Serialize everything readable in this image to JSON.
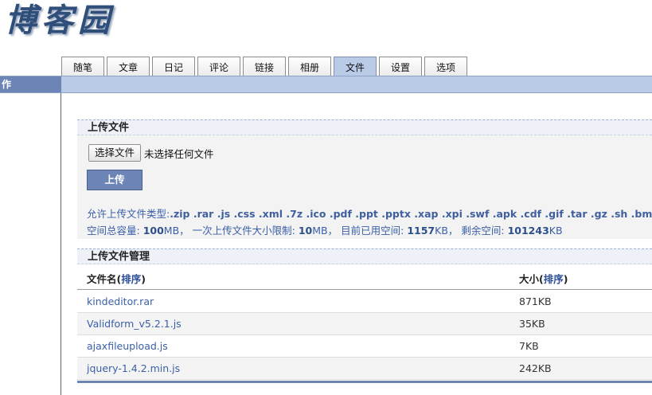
{
  "logo": {
    "text": "博客园"
  },
  "tabs": [
    {
      "label": "随笔"
    },
    {
      "label": "文章"
    },
    {
      "label": "日记"
    },
    {
      "label": "评论"
    },
    {
      "label": "链接"
    },
    {
      "label": "相册"
    },
    {
      "label": "文件",
      "active": true
    },
    {
      "label": "设置"
    },
    {
      "label": "选项"
    }
  ],
  "topbar": {
    "label": "作"
  },
  "upload": {
    "header": "上传文件",
    "choose_button": "选择文件",
    "no_file_text": "未选择任何文件",
    "upload_button": "上传",
    "types_label": "允许上传文件类型:",
    "types_value": ".zip .rar .js .css .xml .7z .ico .pdf .ppt .pptx .xap .xpi .swf .apk .cdf .gif .tar .gz .sh .bmp",
    "quota": {
      "total_label": "空间总容量:",
      "total_value": "100",
      "total_unit": "MB，",
      "single_label": "一次上传文件大小限制:",
      "single_value": "10",
      "single_unit": "MB，",
      "used_label": "目前已用空间:",
      "used_value": "1157",
      "used_unit": "KB，",
      "remain_label": "剩余空间:",
      "remain_value": "101243",
      "remain_unit": "KB"
    }
  },
  "manage": {
    "header": "上传文件管理",
    "col_name": "文件名(",
    "col_size": "大小(",
    "sort_label": "排序",
    "close_paren": ")",
    "files": [
      {
        "name": "kindeditor.rar",
        "size": "871KB"
      },
      {
        "name": "Validform_v5.2.1.js",
        "size": "35KB"
      },
      {
        "name": "ajaxfileupload.js",
        "size": "7KB"
      },
      {
        "name": "jquery-1.4.2.min.js",
        "size": "242KB"
      }
    ]
  },
  "colors": {
    "accent": "#6d85b6",
    "tab_active": "#b9cbe7",
    "link": "#3a5fa8"
  }
}
